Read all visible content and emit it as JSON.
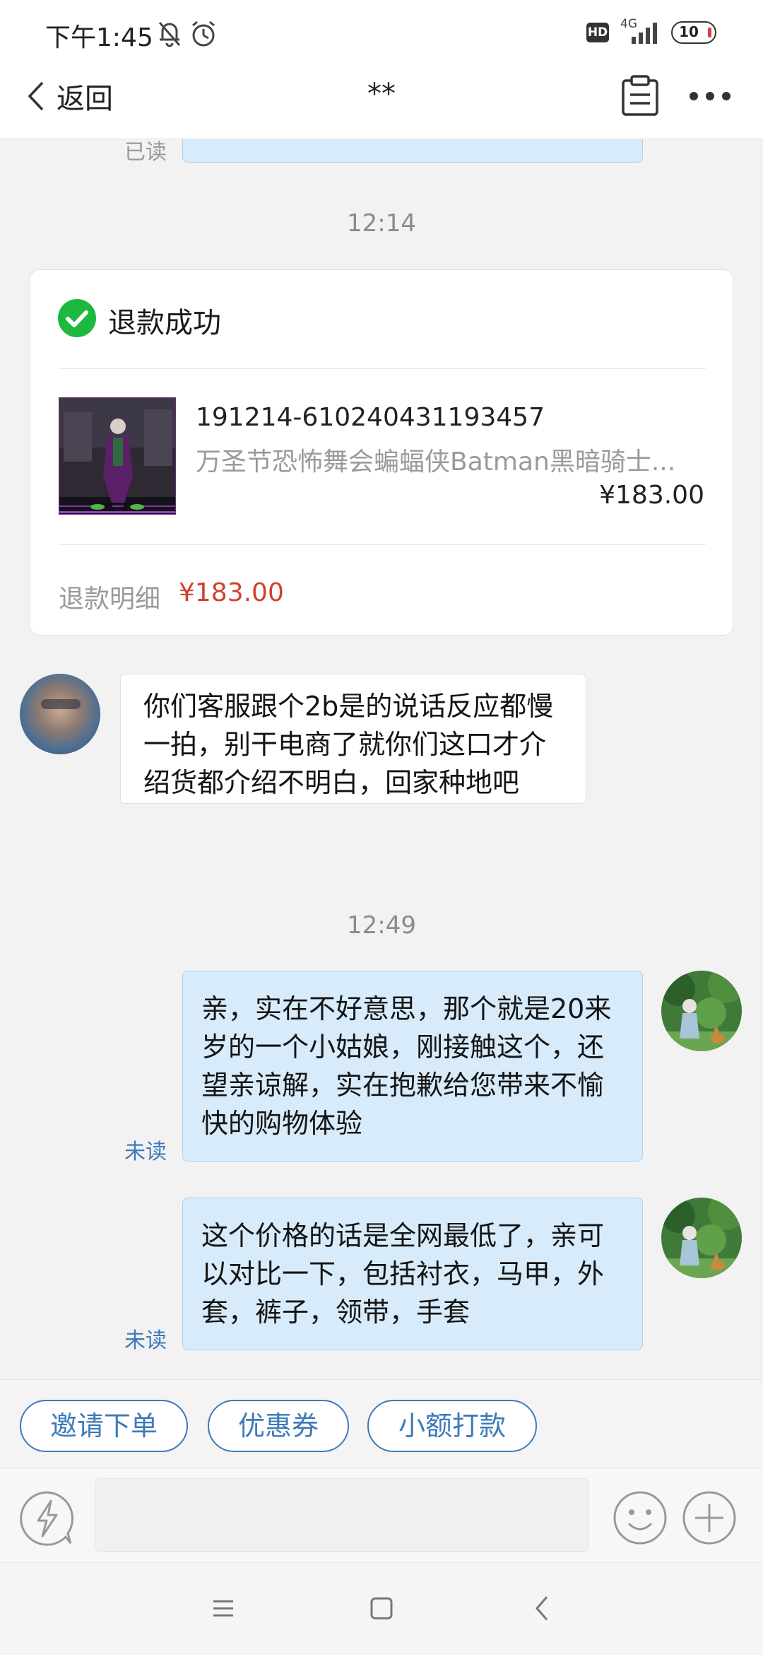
{
  "status_bar": {
    "time": "下午1:45",
    "hd_badge": "HD",
    "network": "4G",
    "battery": "10",
    "icons": [
      "bell-off-icon",
      "alarm-icon",
      "hd-icon",
      "signal-icon",
      "battery-icon"
    ]
  },
  "nav": {
    "back_label": "返回",
    "title": "**",
    "icons": [
      "chevron-left-icon",
      "clipboard-icon",
      "more-icon"
    ]
  },
  "messages": {
    "top_read_label": "已读",
    "time_1": "12:14",
    "refund_card": {
      "status": "退款成功",
      "order_no": "191214-610240431193457",
      "product_name": "万圣节恐怖舞会蝙蝠侠Batman黑暗骑士...",
      "price": "¥183.00",
      "refund_label": "退款明细",
      "refund_amount": "¥183.00"
    },
    "customer_message": "你们客服跟个2b是的说话反应都慢一拍，别干电商了就你们这口才介绍货都介绍不明白，回家种地吧",
    "time_2": "12:49",
    "reply_1": {
      "text": "亲，实在不好意思，那个就是20来岁的一个小姑娘，刚接触这个，还望亲谅解，实在抱歉给您带来不愉快的购物体验",
      "status": "未读"
    },
    "reply_2": {
      "text": "这个价格的话是全网最低了，亲可以对比一下，包括衬衣，马甲，外套，裤子，领带，手套",
      "status": "未读"
    }
  },
  "quick_actions": [
    "邀请下单",
    "优惠券",
    "小额打款"
  ],
  "input_bar": {
    "value": "",
    "icons": [
      "lightning-icon",
      "emoji-icon",
      "plus-icon"
    ]
  },
  "system_nav": {
    "icons": [
      "menu-icon",
      "home-square-icon",
      "back-triangle-icon"
    ]
  },
  "colors": {
    "accent": "#3d7ab8",
    "success": "#1db83f",
    "refund_red": "#d2402f",
    "bubble_self": "#d8ebfb",
    "background": "#f2f2f2"
  }
}
